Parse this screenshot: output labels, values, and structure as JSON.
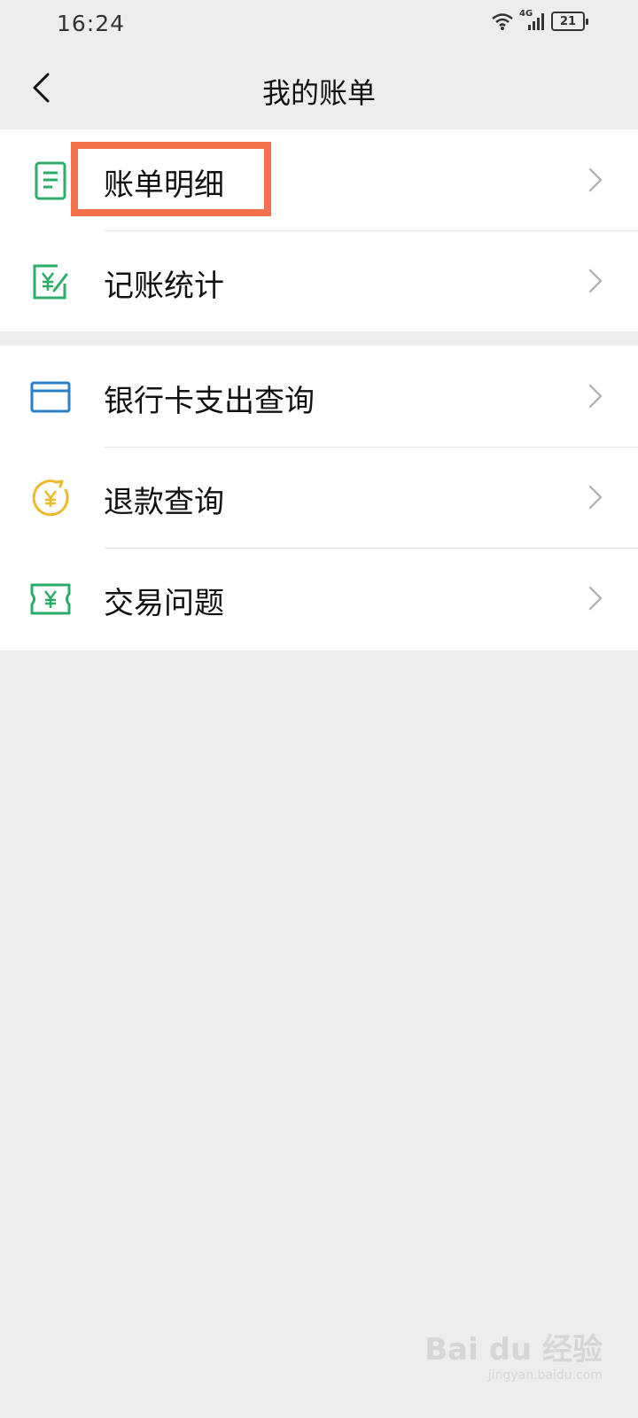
{
  "status_bar": {
    "time": "16:24",
    "network": "4G",
    "battery": "21"
  },
  "header": {
    "title": "我的账单"
  },
  "groups": [
    {
      "items": [
        {
          "label": "账单明细",
          "icon": "bill-detail-icon",
          "color": "#2aae67"
        },
        {
          "label": "记账统计",
          "icon": "bookkeeping-icon",
          "color": "#2aae67"
        }
      ]
    },
    {
      "items": [
        {
          "label": "银行卡支出查询",
          "icon": "bank-card-icon",
          "color": "#2a7fc9"
        },
        {
          "label": "退款查询",
          "icon": "refund-icon",
          "color": "#f0b92b"
        },
        {
          "label": "交易问题",
          "icon": "ticket-icon",
          "color": "#2aae67"
        }
      ]
    }
  ],
  "highlight_color": "#f37148",
  "watermark": {
    "brand": "Bai du 经验",
    "site": "jingyan.baidu.com"
  }
}
